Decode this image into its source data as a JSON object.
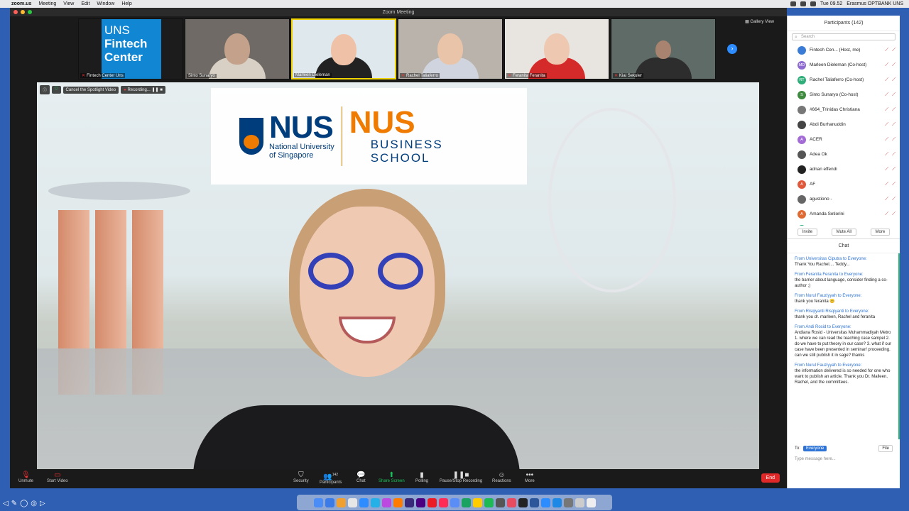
{
  "menubar": {
    "items": [
      "zoom.us",
      "Meeting",
      "View",
      "Edit",
      "Window",
      "Help"
    ],
    "clock": "Tue 09.52",
    "user": "Erasmus OPTBANK UNS"
  },
  "window": {
    "title": "Zoom Meeting",
    "gallery_view_label": "Gallery View"
  },
  "gallery": [
    {
      "name": "Fintech Center Uns",
      "muted": true,
      "logo_line1": "UNS",
      "logo_line2": "Fintech",
      "logo_line3": "Center"
    },
    {
      "name": "Sinto Sunaryo",
      "muted": false
    },
    {
      "name": "Marleen Dieleman",
      "muted": false
    },
    {
      "name": "Rachel Taliaferro",
      "muted": true
    },
    {
      "name": "Feranita Feranita",
      "muted": true
    },
    {
      "name": "Kiai Sekuler",
      "muted": true
    }
  ],
  "spotlight": {
    "cancel_label": "Cancel the Spotlight Video",
    "recording_label": "Recording..."
  },
  "banner": {
    "nus": "NUS",
    "nus_sub1": "National University",
    "nus_sub2": "of Singapore",
    "biz": "NUS",
    "biz_sub1": "BUSINESS",
    "biz_sub2": "SCHOOL"
  },
  "toolbar": {
    "unmute": "Unmute",
    "start_video": "Start Video",
    "security": "Security",
    "participants": "Participants",
    "participants_count": "142",
    "chat": "Chat",
    "share_screen": "Share Screen",
    "polling": "Polling",
    "recording": "Pause/Stop Recording",
    "reactions": "Reactions",
    "more": "More",
    "end": "End"
  },
  "participants_panel": {
    "title": "Participants (142)",
    "search_placeholder": "Search",
    "list": [
      {
        "name": "Fintech Cen... (Host, me)",
        "initials": "",
        "color": "#3a7bd5"
      },
      {
        "name": "Marleen Dieleman (Co-host)",
        "initials": "MD",
        "color": "#8e6bd1"
      },
      {
        "name": "Rachel Taliaferro (Co-host)",
        "initials": "RT",
        "color": "#2fae7a"
      },
      {
        "name": "Sinto Sunaryo (Co-host)",
        "initials": "S",
        "color": "#3f8b3f"
      },
      {
        "name": "#664_Trinidas Christiana",
        "initials": "",
        "color": "#777777"
      },
      {
        "name": "Abdi Burhanuddin",
        "initials": "",
        "color": "#444444"
      },
      {
        "name": "ACER",
        "initials": "A",
        "color": "#a36bd6"
      },
      {
        "name": "Adea Ok",
        "initials": "",
        "color": "#555555"
      },
      {
        "name": "adnan effendi",
        "initials": "",
        "color": "#222222"
      },
      {
        "name": "AF",
        "initials": "A",
        "color": "#e0593c"
      },
      {
        "name": "agustiono -",
        "initials": "",
        "color": "#666666"
      },
      {
        "name": "Amanda Setiorini",
        "initials": "A",
        "color": "#e06a33"
      },
      {
        "name": "Anastasia Riani",
        "initials": "AR",
        "color": "#2fae7a"
      }
    ],
    "invite": "Invite",
    "mute_all": "Mute All",
    "more": "More"
  },
  "chat": {
    "title": "Chat",
    "messages": [
      {
        "from": "From Universitas Ciputra to Everyone:",
        "text": "Thank You Rachel.... Teddy..."
      },
      {
        "from": "From Feranita Feranita to Everyone:",
        "text": "the barrier about language, consider finding a co-author ;)"
      },
      {
        "from": "From Nurul Fauziyyah to Everyone:",
        "text": "thank you feranita 😊"
      },
      {
        "from": "From Risqiyanti Risqiyanti to Everyone:",
        "text": "thank you dr. marleen, Rachel and feranita"
      },
      {
        "from": "From Andi Rosid to Everyone:",
        "text": "Andiana Rosid - Universitas Muhammadiyah Metro 1. where we can read the teaching case sampel 2. do we have to put theory in our case? 3. what if our case have been presented in seminar/ proceeding. can we still publish it in sage? thanks"
      },
      {
        "from": "From Nurul Fauziyyah to Everyone:",
        "text": "the information delivered is so needed for one who want to publish an article. Thank you Dr. Malleen, Rachel, and the committees."
      }
    ],
    "to_label": "To:",
    "recipient": "Everyone",
    "file_label": "File",
    "input_placeholder": "Type message here..."
  }
}
